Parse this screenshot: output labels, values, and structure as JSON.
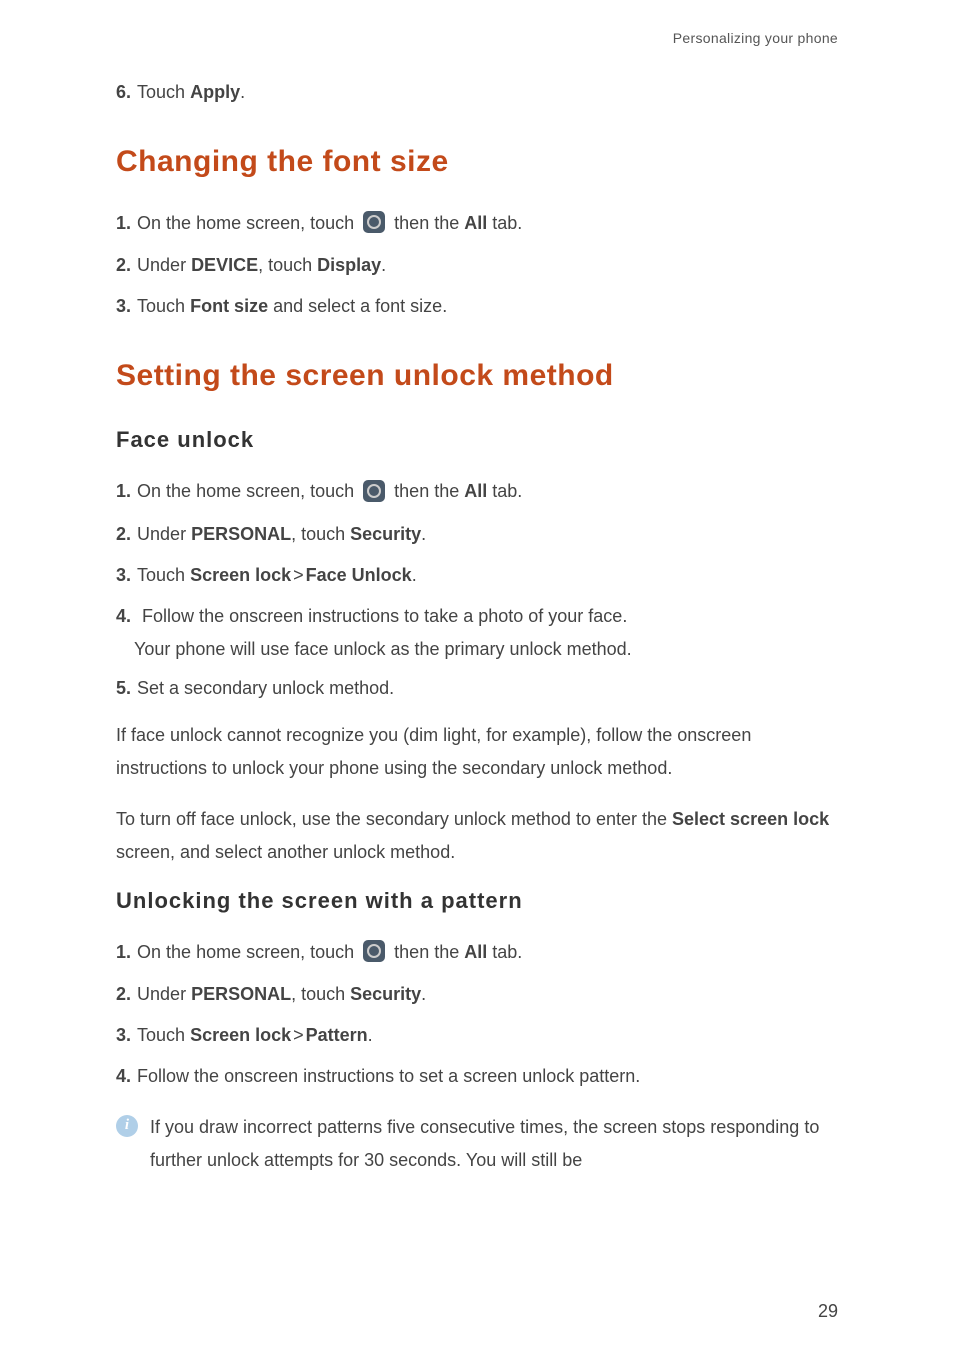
{
  "header": "Personalizing your phone",
  "step6": {
    "num": "6",
    "text_before": "Touch ",
    "bold1": "Apply",
    "text_after": "."
  },
  "section1": {
    "title": "Changing the font size",
    "step1": {
      "num": "1",
      "text_before": "On the home screen, touch ",
      "text_mid": " then the ",
      "bold1": "All",
      "text_after": " tab."
    },
    "step2": {
      "num": "2",
      "text_before": "Under ",
      "bold1": "DEVICE",
      "text_mid": ", touch ",
      "bold2": "Display",
      "text_after": "."
    },
    "step3": {
      "num": "3",
      "text_before": "Touch ",
      "bold1": "Font size",
      "text_after": " and select a font size."
    }
  },
  "section2": {
    "title": "Setting the screen unlock method",
    "sub1": {
      "title": "Face unlock",
      "step1": {
        "num": "1",
        "text_before": "On the home screen, touch ",
        "text_mid": " then the ",
        "bold1": "All",
        "text_after": " tab."
      },
      "step2": {
        "num": "2",
        "text_before": "Under ",
        "bold1": "PERSONAL",
        "text_mid": ", touch ",
        "bold2": "Security",
        "text_after": "."
      },
      "step3": {
        "num": "3",
        "text_before": "Touch ",
        "bold1": "Screen lock",
        "gt": ">",
        "bold2": "Face Unlock",
        "text_after": "."
      },
      "step4": {
        "num": "4",
        "line1": "Follow the onscreen instructions to take a photo of your face.",
        "line2": "Your phone will use face unlock as the primary unlock method."
      },
      "step5": {
        "num": "5",
        "text": "Set a secondary unlock method."
      },
      "para1": "If face unlock cannot recognize you (dim light, for example), follow the onscreen instructions to unlock your phone using the secondary unlock method.",
      "para2_before": "To turn off face unlock, use the secondary unlock method to enter the ",
      "para2_bold1": "Select screen lock",
      "para2_after": " screen, and select another unlock method."
    },
    "sub2": {
      "title": "Unlocking the screen with a pattern",
      "step1": {
        "num": "1",
        "text_before": "On the home screen, touch ",
        "text_mid": " then the ",
        "bold1": "All",
        "text_after": " tab."
      },
      "step2": {
        "num": "2",
        "text_before": "Under ",
        "bold1": "PERSONAL",
        "text_mid": ", touch ",
        "bold2": "Security",
        "text_after": "."
      },
      "step3": {
        "num": "3",
        "text_before": "Touch ",
        "bold1": "Screen lock",
        "gt": ">",
        "bold2": "Pattern",
        "text_after": "."
      },
      "step4": {
        "num": "4",
        "text": "Follow the onscreen instructions to set a screen unlock pattern."
      },
      "info": "If you draw incorrect patterns five consecutive times, the screen stops responding to further unlock attempts for 30 seconds. You will still be"
    }
  },
  "page_number": "29",
  "info_icon_label": "i"
}
